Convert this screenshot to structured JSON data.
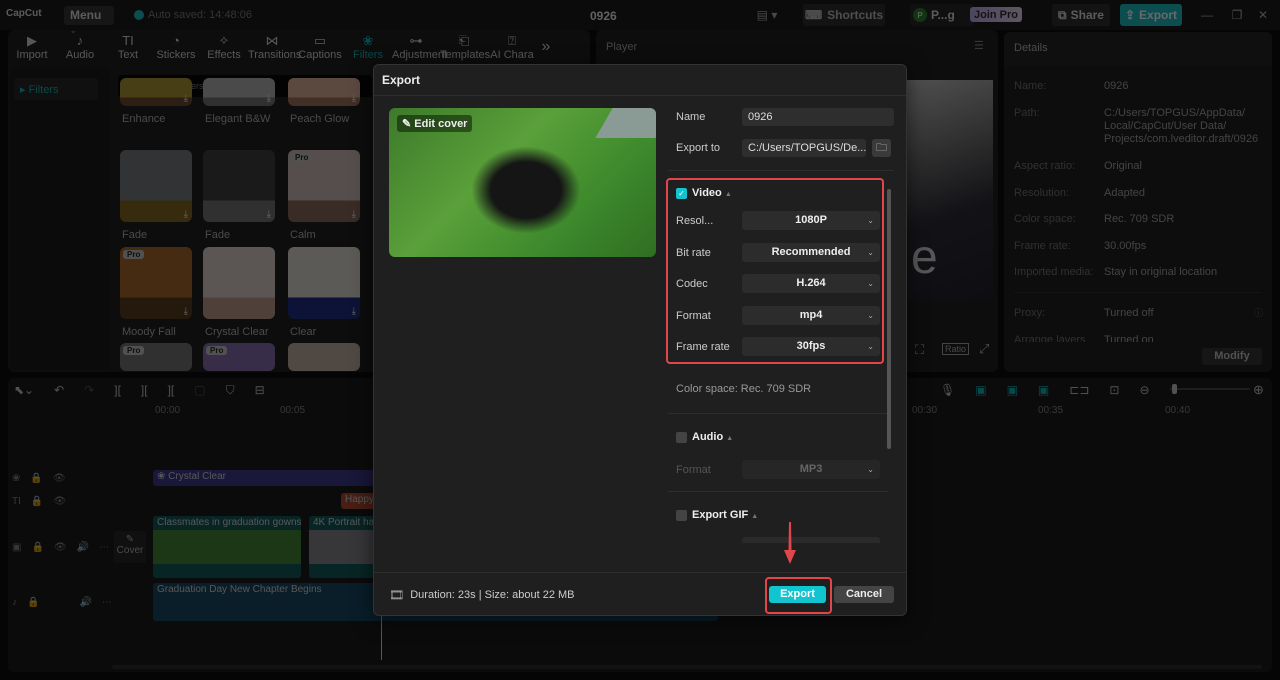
{
  "app": {
    "logo": "CapCut",
    "menu_label": "Menu",
    "autosave": "Auto saved: 14:48:06",
    "project_title": "0926",
    "shortcuts_label": "Shortcuts",
    "user_initial": "P",
    "user_name": "P...g",
    "join_pro_label": "Join Pro",
    "share_label": "Share",
    "export_label": "Export"
  },
  "toolbar": {
    "tools": [
      {
        "label": "Import",
        "icon": "import-icon",
        "glyph": "▶"
      },
      {
        "label": "Audio",
        "icon": "audio-icon",
        "glyph": "♪"
      },
      {
        "label": "Text",
        "icon": "text-icon",
        "glyph": "TI"
      },
      {
        "label": "Stickers",
        "icon": "stickers-icon",
        "glyph": "◔"
      },
      {
        "label": "Effects",
        "icon": "effects-icon",
        "glyph": "✧"
      },
      {
        "label": "Transitions",
        "icon": "transitions-icon",
        "glyph": "⋈"
      },
      {
        "label": "Captions",
        "icon": "captions-icon",
        "glyph": "▭"
      },
      {
        "label": "Filters",
        "icon": "filters-icon",
        "glyph": "❀"
      },
      {
        "label": "Adjustment",
        "icon": "adjustment-icon",
        "glyph": "⊶"
      },
      {
        "label": "Templates",
        "icon": "templates-icon",
        "glyph": "⎗"
      },
      {
        "label": "AI Chara",
        "icon": "ai-character-icon",
        "glyph": "⍰"
      }
    ],
    "more_glyph": "»"
  },
  "filters_panel": {
    "sidebar_item": "Filters",
    "search_placeholder": "Search for filters",
    "cards": [
      {
        "label": "Enhance",
        "pro": false
      },
      {
        "label": "Elegant B&W",
        "pro": false
      },
      {
        "label": "Peach Glow",
        "pro": false
      },
      {
        "label": "Fade",
        "pro": false
      },
      {
        "label": "Fade",
        "pro": false
      },
      {
        "label": "Calm",
        "pro": true
      },
      {
        "label": "Moody Fall",
        "pro": true
      },
      {
        "label": "Crystal Clear",
        "pro": false
      },
      {
        "label": "Clear",
        "pro": false
      }
    ],
    "pro_badge": "Pro"
  },
  "player": {
    "title": "Player",
    "ratio_label": "Ratio"
  },
  "details": {
    "title": "Details",
    "rows": [
      {
        "key": "Name:",
        "value": "0926"
      },
      {
        "key": "Path:",
        "value": "C:/Users/TOPGUS/AppData/ Local/CapCut/User Data/ Projects/com.lveditor.draft/0926"
      },
      {
        "key": "Aspect ratio:",
        "value": "Original"
      },
      {
        "key": "Resolution:",
        "value": "Adapted"
      },
      {
        "key": "Color space:",
        "value": "Rec. 709 SDR"
      },
      {
        "key": "Frame rate:",
        "value": "30.00fps"
      },
      {
        "key": "Imported media:",
        "value": "Stay in original location"
      },
      {
        "key": "Proxy:",
        "value": "Turned off"
      },
      {
        "key": "Arrange layers",
        "value": "Turned on"
      }
    ],
    "modify_label": "Modify"
  },
  "export_dialog": {
    "title": "Export",
    "edit_cover": "Edit cover",
    "name_label": "Name",
    "name_value": "0926",
    "export_to_label": "Export to",
    "export_to_value": "C:/Users/TOPGUS/De...",
    "video": {
      "title": "Video",
      "checked": true,
      "settings": [
        {
          "label": "Resol...",
          "value": "1080P"
        },
        {
          "label": "Bit rate",
          "value": "Recommended"
        },
        {
          "label": "Codec",
          "value": "H.264"
        },
        {
          "label": "Format",
          "value": "mp4"
        },
        {
          "label": "Frame rate",
          "value": "30fps"
        }
      ],
      "color_space": "Color space: Rec. 709 SDR"
    },
    "audio": {
      "title": "Audio",
      "checked": false,
      "format_label": "Format",
      "format_value": "MP3"
    },
    "gif": {
      "title": "Export GIF",
      "checked": false
    },
    "footer_info": "Duration: 23s | Size: about 22 MB",
    "export_button": "Export",
    "cancel_button": "Cancel",
    "highlight_color": "#e0464a",
    "accent_color": "#11c4d0"
  },
  "timeline": {
    "ticks": [
      "00:00",
      "00:05",
      "00:30",
      "00:35",
      "00:40"
    ],
    "clips": {
      "filter": "Crystal Clear",
      "text": "Happy",
      "video1": "Classmates in graduation gowns",
      "video2": "4K Portrait ha",
      "audio": "Graduation Day New Chapter Begins"
    },
    "cover_label": "Cover"
  }
}
